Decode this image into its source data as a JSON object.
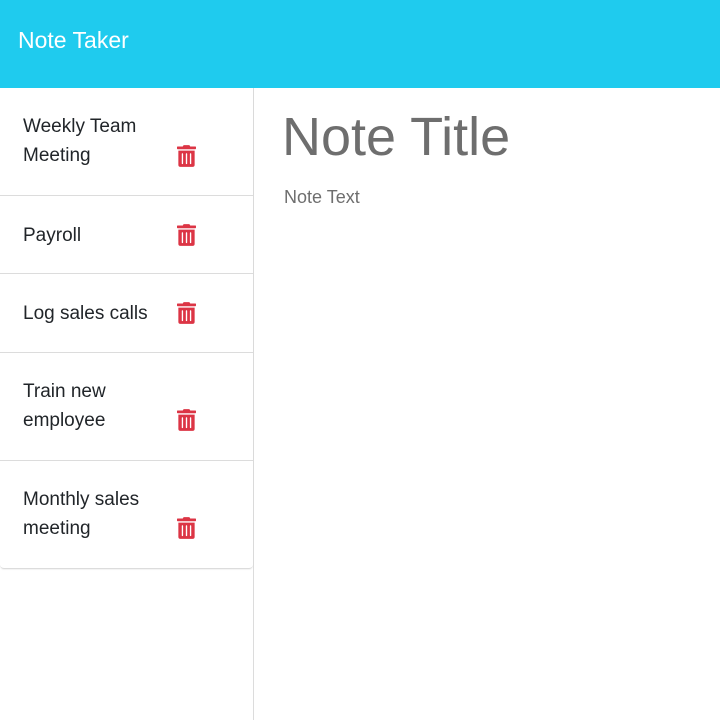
{
  "app": {
    "title": "Note Taker",
    "accent_color": "#1fcbee"
  },
  "sidebar": {
    "notes": [
      {
        "title": "Weekly Team Meeting",
        "delete_icon": "trash-icon"
      },
      {
        "title": "Payroll",
        "delete_icon": "trash-icon"
      },
      {
        "title": "Log sales calls",
        "delete_icon": "trash-icon"
      },
      {
        "title": "Train new employee",
        "delete_icon": "trash-icon"
      },
      {
        "title": "Monthly sales meeting",
        "delete_icon": "trash-icon"
      }
    ],
    "delete_icon_color": "#dc3545"
  },
  "editor": {
    "title_placeholder": "Note Title",
    "text_placeholder": "Note Text"
  }
}
